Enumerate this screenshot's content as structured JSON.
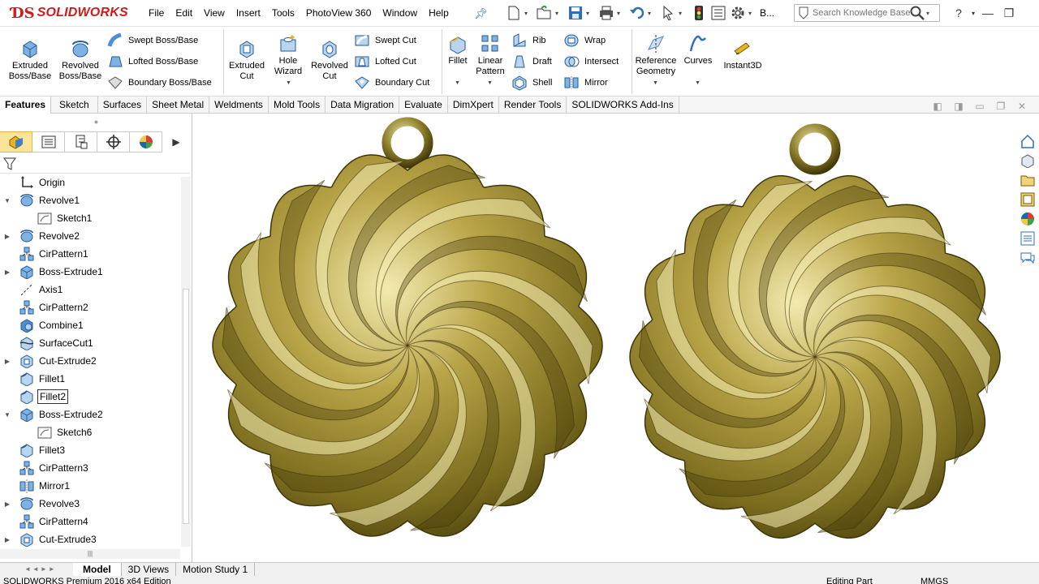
{
  "app": {
    "brand": "SOLIDWORKS"
  },
  "menu": [
    "File",
    "Edit",
    "View",
    "Insert",
    "Tools",
    "PhotoView 360",
    "Window",
    "Help"
  ],
  "quick_access": [
    "new-document-icon",
    "open-icon",
    "save-icon",
    "print-icon",
    "undo-icon",
    "select-icon",
    "rebuild-icon",
    "file-properties-icon",
    "options-icon"
  ],
  "quick_extra_label": "B...",
  "search": {
    "placeholder": "Search Knowledge Base"
  },
  "window_controls": {
    "help": "?",
    "minimize": "—",
    "restore": "❐"
  },
  "ribbon": {
    "extruded_boss": "Extruded\nBoss/Base",
    "revolved_boss": "Revolved\nBoss/Base",
    "swept_boss": "Swept Boss/Base",
    "lofted_boss": "Lofted Boss/Base",
    "boundary_boss": "Boundary Boss/Base",
    "extruded_cut": "Extruded\nCut",
    "hole_wizard": "Hole\nWizard",
    "revolved_cut": "Revolved\nCut",
    "swept_cut": "Swept Cut",
    "lofted_cut": "Lofted Cut",
    "boundary_cut": "Boundary Cut",
    "fillet": "Fillet",
    "linear_pattern": "Linear\nPattern",
    "rib": "Rib",
    "draft": "Draft",
    "shell": "Shell",
    "wrap": "Wrap",
    "intersect": "Intersect",
    "mirror": "Mirror",
    "reference_geometry": "Reference\nGeometry",
    "curves": "Curves",
    "instant3d": "Instant3D"
  },
  "command_tabs": [
    "Features",
    "Sketch",
    "Surfaces",
    "Sheet Metal",
    "Weldments",
    "Mold Tools",
    "Data Migration",
    "Evaluate",
    "DimXpert",
    "Render Tools",
    "SOLIDWORKS Add-Ins"
  ],
  "active_command_tab": "Features",
  "feature_tree": [
    {
      "label": "Origin",
      "icon": "origin-icon",
      "level": 0,
      "expander": ""
    },
    {
      "label": "Revolve1",
      "icon": "revolve-icon",
      "level": 0,
      "expander": "▼"
    },
    {
      "label": "Sketch1",
      "icon": "sketch-icon",
      "level": 1,
      "expander": ""
    },
    {
      "label": "Revolve2",
      "icon": "revolve-icon",
      "level": 0,
      "expander": "▶"
    },
    {
      "label": "CirPattern1",
      "icon": "circular-pattern-icon",
      "level": 0,
      "expander": ""
    },
    {
      "label": "Boss-Extrude1",
      "icon": "extrude-icon",
      "level": 0,
      "expander": "▶"
    },
    {
      "label": "Axis1",
      "icon": "axis-icon",
      "level": 0,
      "expander": ""
    },
    {
      "label": "CirPattern2",
      "icon": "circular-pattern-icon",
      "level": 0,
      "expander": ""
    },
    {
      "label": "Combine1",
      "icon": "combine-icon",
      "level": 0,
      "expander": ""
    },
    {
      "label": "SurfaceCut1",
      "icon": "surface-cut-icon",
      "level": 0,
      "expander": ""
    },
    {
      "label": "Cut-Extrude2",
      "icon": "cut-extrude-icon",
      "level": 0,
      "expander": "▶"
    },
    {
      "label": "Fillet1",
      "icon": "fillet-icon",
      "level": 0,
      "expander": ""
    },
    {
      "label": "Fillet2",
      "icon": "fillet-icon",
      "level": 0,
      "expander": "",
      "selected": true
    },
    {
      "label": "Boss-Extrude2",
      "icon": "extrude-icon",
      "level": 0,
      "expander": "▼"
    },
    {
      "label": "Sketch6",
      "icon": "sketch-icon",
      "level": 1,
      "expander": ""
    },
    {
      "label": "Fillet3",
      "icon": "fillet-icon",
      "level": 0,
      "expander": ""
    },
    {
      "label": "CirPattern3",
      "icon": "circular-pattern-icon",
      "level": 0,
      "expander": ""
    },
    {
      "label": "Mirror1",
      "icon": "mirror-icon",
      "level": 0,
      "expander": ""
    },
    {
      "label": "Revolve3",
      "icon": "revolve-icon",
      "level": 0,
      "expander": "▶"
    },
    {
      "label": "CirPattern4",
      "icon": "circular-pattern-icon",
      "level": 0,
      "expander": ""
    },
    {
      "label": "Cut-Extrude3",
      "icon": "cut-extrude-icon",
      "level": 0,
      "expander": "▶"
    }
  ],
  "bottom_tabs": [
    "Model",
    "3D Views",
    "Motion Study 1"
  ],
  "active_bottom_tab": "Model",
  "status": {
    "left": "SOLIDWORKS Premium 2016 x64 Edition",
    "mode": "Editing Part",
    "units": "MMGS"
  },
  "colors": {
    "brand_red": "#d21a1a",
    "gold_light": "#efe7a0",
    "gold_mid": "#9c8b2e",
    "gold_dark": "#3f3608"
  }
}
